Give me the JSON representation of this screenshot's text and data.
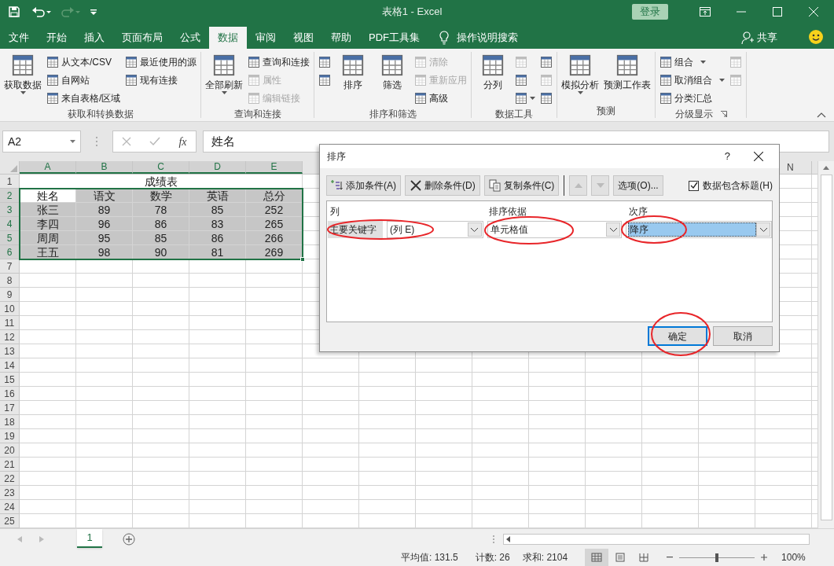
{
  "window": {
    "title": "表格1  -  Excel",
    "signin": "登录"
  },
  "tabs": [
    {
      "label": "文件",
      "selected": false
    },
    {
      "label": "开始",
      "selected": false
    },
    {
      "label": "插入",
      "selected": false
    },
    {
      "label": "页面布局",
      "selected": false
    },
    {
      "label": "公式",
      "selected": false
    },
    {
      "label": "数据",
      "selected": true
    },
    {
      "label": "审阅",
      "selected": false
    },
    {
      "label": "视图",
      "selected": false
    },
    {
      "label": "帮助",
      "selected": false
    },
    {
      "label": "PDF工具集",
      "selected": false
    }
  ],
  "tell_me": "操作说明搜索",
  "share": "共享",
  "ribbon": [
    {
      "label": "获取和转换数据",
      "columns": [
        [
          {
            "kind": "large",
            "label": "获取数据",
            "dropdown": true,
            "disabled": false
          }
        ],
        [
          {
            "kind": "small",
            "label": "从文本/CSV",
            "dropdown": false,
            "disabled": false
          },
          {
            "kind": "small",
            "label": "自网站",
            "dropdown": false,
            "disabled": false
          },
          {
            "kind": "small",
            "label": "来自表格/区域",
            "dropdown": false,
            "disabled": false
          }
        ],
        [
          {
            "kind": "small",
            "label": "最近使用的源",
            "dropdown": false,
            "disabled": false
          },
          {
            "kind": "small",
            "label": "现有连接",
            "dropdown": false,
            "disabled": false
          }
        ]
      ]
    },
    {
      "label": "查询和连接",
      "columns": [
        [
          {
            "kind": "large",
            "label": "全部刷新",
            "dropdown": true,
            "disabled": false
          }
        ],
        [
          {
            "kind": "small",
            "label": "查询和连接",
            "dropdown": false,
            "disabled": false
          },
          {
            "kind": "small",
            "label": "属性",
            "dropdown": false,
            "disabled": true
          },
          {
            "kind": "small",
            "label": "编辑链接",
            "dropdown": false,
            "disabled": true
          }
        ]
      ]
    },
    {
      "label": "排序和筛选",
      "columns": [
        [
          {
            "kind": "icon",
            "dropdown": false,
            "disabled": false
          },
          {
            "kind": "icon",
            "dropdown": false,
            "disabled": false
          }
        ],
        [
          {
            "kind": "large",
            "label": "排序",
            "dropdown": false,
            "disabled": false
          }
        ],
        [
          {
            "kind": "large",
            "label": "筛选",
            "dropdown": false,
            "disabled": false
          }
        ],
        [
          {
            "kind": "small",
            "label": "清除",
            "dropdown": false,
            "disabled": true
          },
          {
            "kind": "small",
            "label": "重新应用",
            "dropdown": false,
            "disabled": true
          },
          {
            "kind": "small",
            "label": "高级",
            "dropdown": false,
            "disabled": false
          }
        ]
      ]
    },
    {
      "label": "数据工具",
      "columns": [
        [
          {
            "kind": "large",
            "label": "分列",
            "dropdown": false,
            "disabled": false
          }
        ],
        [
          {
            "kind": "icon",
            "dropdown": false,
            "disabled": true
          },
          {
            "kind": "icon",
            "dropdown": false,
            "disabled": false
          },
          {
            "kind": "icon",
            "dropdown": true,
            "disabled": false
          }
        ],
        [
          {
            "kind": "icon",
            "dropdown": false,
            "disabled": false
          },
          {
            "kind": "icon",
            "dropdown": false,
            "disabled": true
          },
          {
            "kind": "icon",
            "dropdown": false,
            "disabled": false
          }
        ]
      ]
    },
    {
      "label": "预测",
      "columns": [
        [
          {
            "kind": "large",
            "label": "模拟分析",
            "dropdown": true,
            "disabled": false
          }
        ],
        [
          {
            "kind": "large",
            "label": "预测工作表",
            "dropdown": false,
            "disabled": false
          }
        ]
      ]
    },
    {
      "label": "分级显示",
      "columns": [
        [
          {
            "kind": "small",
            "label": "组合",
            "dropdown": true,
            "disabled": false
          },
          {
            "kind": "small",
            "label": "取消组合",
            "dropdown": true,
            "disabled": false
          },
          {
            "kind": "small",
            "label": "分类汇总",
            "dropdown": false,
            "disabled": false
          }
        ],
        [
          {
            "kind": "icon",
            "dropdown": false,
            "disabled": true
          },
          {
            "kind": "icon",
            "dropdown": false,
            "disabled": true
          }
        ]
      ]
    }
  ],
  "name_box": "A2",
  "insert_function": "fx",
  "formula": "姓名",
  "sheet": {
    "columns": [
      "A",
      "B",
      "C",
      "D",
      "E"
    ],
    "last_column": "N",
    "range_selected": true,
    "row_numbers": [
      "1",
      "2",
      "3",
      "4",
      "5",
      "6",
      "7",
      "8",
      "9",
      "10",
      "11",
      "12",
      "13",
      "14",
      "15",
      "16",
      "17",
      "18",
      "19",
      "20",
      "21",
      "22",
      "23",
      "24",
      "25"
    ],
    "title": "成绩表",
    "header": [
      {
        "text": "姓名",
        "active": true
      },
      {
        "text": "语文",
        "active": false
      },
      {
        "text": "数学",
        "active": false
      },
      {
        "text": "英语",
        "active": false
      },
      {
        "text": "总分",
        "active": false
      }
    ],
    "rows": [
      [
        "张三",
        "89",
        "78",
        "85",
        "252"
      ],
      [
        "李四",
        "96",
        "86",
        "83",
        "265"
      ],
      [
        "周周",
        "95",
        "85",
        "86",
        "266"
      ],
      [
        "王五",
        "98",
        "90",
        "81",
        "269"
      ]
    ]
  },
  "sheet_tabs": [
    {
      "label": "1",
      "selected": true
    }
  ],
  "status_bar": {
    "average": "平均值: 131.5",
    "count": "计数: 26",
    "sum": "求和: 2104",
    "views": [
      {
        "kind": "normal",
        "selected": true
      },
      {
        "kind": "page_layout",
        "selected": false
      },
      {
        "kind": "page_break",
        "selected": false
      }
    ],
    "zoom": {
      "level": 0.5,
      "label": "100%"
    }
  },
  "dialog": {
    "title": "排序",
    "help": "?",
    "toolbar": [
      {
        "kind": "add",
        "label": "添加条件(A)",
        "disabled": false
      },
      {
        "kind": "delete",
        "label": "删除条件(D)",
        "disabled": false
      },
      {
        "kind": "copy",
        "label": "复制条件(C)",
        "disabled": false
      },
      {
        "kind": "up",
        "disabled": true
      },
      {
        "kind": "down",
        "disabled": true
      },
      {
        "kind": "options",
        "label": "选项(O)...",
        "disabled": false
      }
    ],
    "has_headers": {
      "label": "数据包含标题(H)",
      "checked": true
    },
    "headings": [
      "列",
      "排序依据",
      "次序"
    ],
    "levels": [
      {
        "label": "主要关键字",
        "column": "(列 E)",
        "sort_on": "单元格值",
        "order": "降序",
        "selected": true,
        "circled": true
      }
    ],
    "ok": {
      "label": "确定",
      "circled": true
    },
    "cancel": "取消"
  }
}
